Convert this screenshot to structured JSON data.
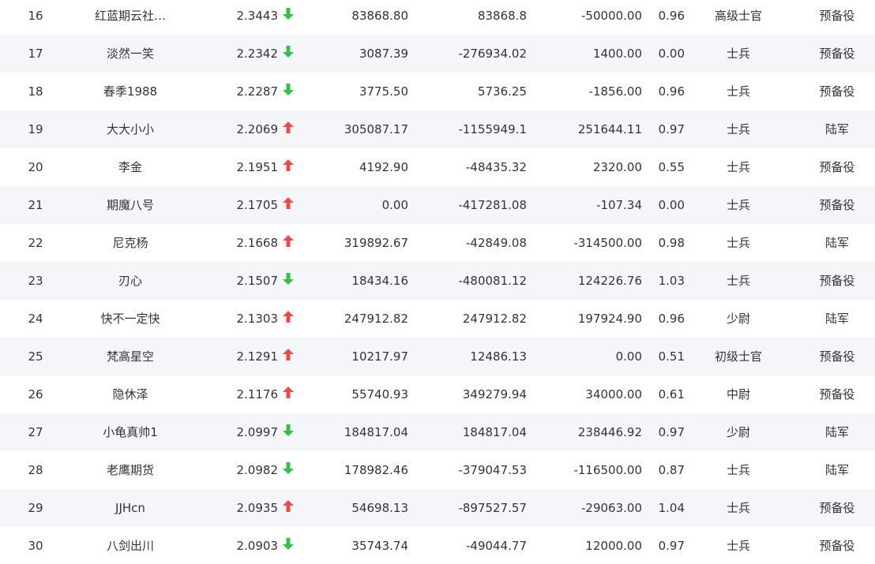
{
  "colors": {
    "up": "#e84b4b",
    "down": "#36bf47",
    "row_alt_bg": "#f5f6f9",
    "text": "#333333"
  },
  "rows": [
    {
      "rank": "16",
      "name": "红蓝期云社…",
      "score": "2.3443",
      "trend": "down",
      "v1": "83868.80",
      "v2": "83868.8",
      "v3": "-50000.00",
      "ratio": "0.96",
      "title": "高级士官",
      "branch": "预备役"
    },
    {
      "rank": "17",
      "name": "淡然一笑",
      "score": "2.2342",
      "trend": "down",
      "v1": "3087.39",
      "v2": "-276934.02",
      "v3": "1400.00",
      "ratio": "0.00",
      "title": "士兵",
      "branch": "预备役"
    },
    {
      "rank": "18",
      "name": "春季1988",
      "score": "2.2287",
      "trend": "down",
      "v1": "3775.50",
      "v2": "5736.25",
      "v3": "-1856.00",
      "ratio": "0.96",
      "title": "士兵",
      "branch": "预备役"
    },
    {
      "rank": "19",
      "name": "大大小小",
      "score": "2.2069",
      "trend": "up",
      "v1": "305087.17",
      "v2": "-1155949.1",
      "v3": "251644.11",
      "ratio": "0.97",
      "title": "士兵",
      "branch": "陆军"
    },
    {
      "rank": "20",
      "name": "李金",
      "score": "2.1951",
      "trend": "up",
      "v1": "4192.90",
      "v2": "-48435.32",
      "v3": "2320.00",
      "ratio": "0.55",
      "title": "士兵",
      "branch": "预备役"
    },
    {
      "rank": "21",
      "name": "期魔八号",
      "score": "2.1705",
      "trend": "up",
      "v1": "0.00",
      "v2": "-417281.08",
      "v3": "-107.34",
      "ratio": "0.00",
      "title": "士兵",
      "branch": "预备役"
    },
    {
      "rank": "22",
      "name": "尼克杨",
      "score": "2.1668",
      "trend": "up",
      "v1": "319892.67",
      "v2": "-42849.08",
      "v3": "-314500.00",
      "ratio": "0.98",
      "title": "士兵",
      "branch": "陆军"
    },
    {
      "rank": "23",
      "name": "刃心",
      "score": "2.1507",
      "trend": "down",
      "v1": "18434.16",
      "v2": "-480081.12",
      "v3": "124226.76",
      "ratio": "1.03",
      "title": "士兵",
      "branch": "预备役"
    },
    {
      "rank": "24",
      "name": "快不一定快",
      "score": "2.1303",
      "trend": "up",
      "v1": "247912.82",
      "v2": "247912.82",
      "v3": "197924.90",
      "ratio": "0.96",
      "title": "少尉",
      "branch": "陆军"
    },
    {
      "rank": "25",
      "name": "梵高星空",
      "score": "2.1291",
      "trend": "up",
      "v1": "10217.97",
      "v2": "12486.13",
      "v3": "0.00",
      "ratio": "0.51",
      "title": "初级士官",
      "branch": "预备役"
    },
    {
      "rank": "26",
      "name": "隐休泽",
      "score": "2.1176",
      "trend": "up",
      "v1": "55740.93",
      "v2": "349279.94",
      "v3": "34000.00",
      "ratio": "0.61",
      "title": "中尉",
      "branch": "预备役"
    },
    {
      "rank": "27",
      "name": "小龟真帅1",
      "score": "2.0997",
      "trend": "down",
      "v1": "184817.04",
      "v2": "184817.04",
      "v3": "238446.92",
      "ratio": "0.97",
      "title": "少尉",
      "branch": "陆军"
    },
    {
      "rank": "28",
      "name": "老鹰期货",
      "score": "2.0982",
      "trend": "down",
      "v1": "178982.46",
      "v2": "-379047.53",
      "v3": "-116500.00",
      "ratio": "0.87",
      "title": "士兵",
      "branch": "陆军"
    },
    {
      "rank": "29",
      "name": "JJHcn",
      "score": "2.0935",
      "trend": "up",
      "v1": "54698.13",
      "v2": "-897527.57",
      "v3": "-29063.00",
      "ratio": "1.04",
      "title": "士兵",
      "branch": "预备役"
    },
    {
      "rank": "30",
      "name": "八剑出川",
      "score": "2.0903",
      "trend": "down",
      "v1": "35743.74",
      "v2": "-49044.77",
      "v3": "12000.00",
      "ratio": "0.97",
      "title": "士兵",
      "branch": "预备役"
    }
  ]
}
